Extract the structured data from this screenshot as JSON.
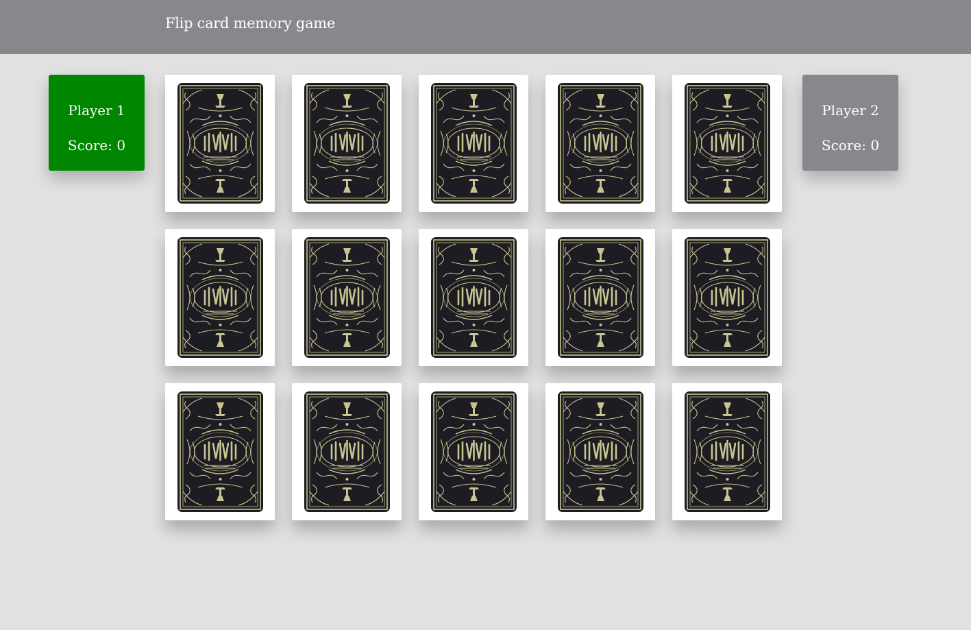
{
  "header": {
    "title": "Flip card memory game"
  },
  "players": [
    {
      "name": "Player 1",
      "score_text": "Score: 0",
      "active": true
    },
    {
      "name": "Player 2",
      "score_text": "Score: 0",
      "active": false
    }
  ],
  "colors": {
    "header_bg": "#86888c",
    "page_bg": "#e1e1e1",
    "active_player": "#008600",
    "inactive_player": "#86888c",
    "card_face": "#ffffff",
    "card_back_dark": "#1d1c22",
    "card_back_ornament": "#c9c592"
  },
  "board": {
    "rows": 3,
    "columns": 5,
    "cards": [
      {
        "state": "face-down"
      },
      {
        "state": "face-down"
      },
      {
        "state": "face-down"
      },
      {
        "state": "face-down"
      },
      {
        "state": "face-down"
      },
      {
        "state": "face-down"
      },
      {
        "state": "face-down"
      },
      {
        "state": "face-down"
      },
      {
        "state": "face-down"
      },
      {
        "state": "face-down"
      },
      {
        "state": "face-down"
      },
      {
        "state": "face-down"
      },
      {
        "state": "face-down"
      },
      {
        "state": "face-down"
      },
      {
        "state": "face-down"
      }
    ]
  }
}
